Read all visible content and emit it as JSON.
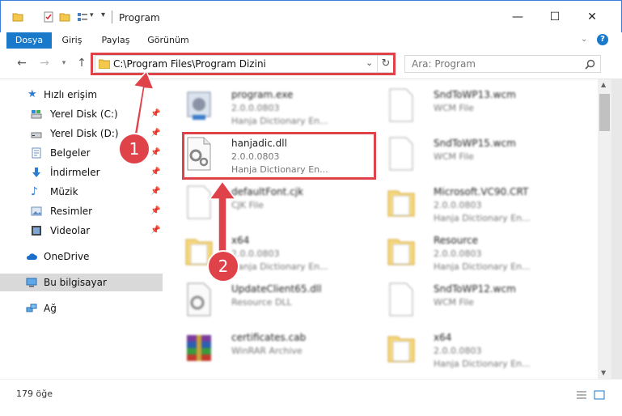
{
  "window": {
    "title": "Program",
    "minimize": "—",
    "maximize": "☐",
    "close": "✕"
  },
  "ribbon": {
    "tabs": [
      "Dosya",
      "Giriş",
      "Paylaş",
      "Görünüm"
    ],
    "help": "?"
  },
  "nav": {
    "path": "C:\\Program Files\\Program Dizini",
    "search_placeholder": "Ara: Program"
  },
  "sidebar": {
    "items": [
      {
        "label": "Hızlı erişim",
        "icon": "star-icon"
      },
      {
        "label": "Yerel Disk (C:)",
        "icon": "drive-icon",
        "pinned": true
      },
      {
        "label": "Yerel Disk (D:)",
        "icon": "drive-icon",
        "pinned": true
      },
      {
        "label": "Belgeler",
        "icon": "documents-icon",
        "pinned": true
      },
      {
        "label": "İndirmeler",
        "icon": "download-icon",
        "pinned": true
      },
      {
        "label": "Müzik",
        "icon": "music-icon",
        "pinned": true
      },
      {
        "label": "Resimler",
        "icon": "pictures-icon",
        "pinned": true
      },
      {
        "label": "Videolar",
        "icon": "videos-icon",
        "pinned": true
      },
      {
        "label": "OneDrive",
        "icon": "cloud-icon"
      },
      {
        "label": "Bu bilgisayar",
        "icon": "computer-icon",
        "selected": true
      },
      {
        "label": "Ağ",
        "icon": "network-icon"
      }
    ]
  },
  "files": [
    {
      "name": "program.exe",
      "line1": "2.0.0.0803",
      "line2": "Hanja Dictionary En...",
      "icon": "exe-icon"
    },
    {
      "name": "SndToWP13.wcm",
      "line1": "WCM File",
      "line2": "",
      "icon": "file-icon"
    },
    {
      "name": "hanjadic.dll",
      "line1": "2.0.0.0803",
      "line2": "Hanja Dictionary En...",
      "icon": "dll-icon"
    },
    {
      "name": "SndToWP15.wcm",
      "line1": "WCM File",
      "line2": "",
      "icon": "file-icon"
    },
    {
      "name": "defaultFont.cjk",
      "line1": "CJK File",
      "line2": "",
      "icon": "file-icon"
    },
    {
      "name": "Microsoft.VC90.CRT",
      "line1": "2.0.0.0803",
      "line2": "Hanja Dictionary En...",
      "icon": "folder-icon"
    },
    {
      "name": "x64",
      "line1": "2.0.0.0803",
      "line2": "Hanja Dictionary En...",
      "icon": "folder-icon"
    },
    {
      "name": "Resource",
      "line1": "2.0.0.0803",
      "line2": "Hanja Dictionary En...",
      "icon": "folder-icon"
    },
    {
      "name": "UpdateClient65.dll",
      "line1": "Resource DLL",
      "line2": "",
      "icon": "dll-icon"
    },
    {
      "name": "SndToWP12.wcm",
      "line1": "WCM File",
      "line2": "",
      "icon": "file-icon"
    },
    {
      "name": "certificates.cab",
      "line1": "WinRAR Archive",
      "line2": "",
      "icon": "archive-icon"
    },
    {
      "name": "x64",
      "line1": "2.0.0.0803",
      "line2": "Hanja Dictionary En...",
      "icon": "folder-icon"
    }
  ],
  "status": {
    "count": "179 öğe"
  },
  "annotations": {
    "badge1": "1",
    "badge2": "2"
  },
  "colors": {
    "accent": "#1979ca",
    "highlight": "#e0424a"
  }
}
